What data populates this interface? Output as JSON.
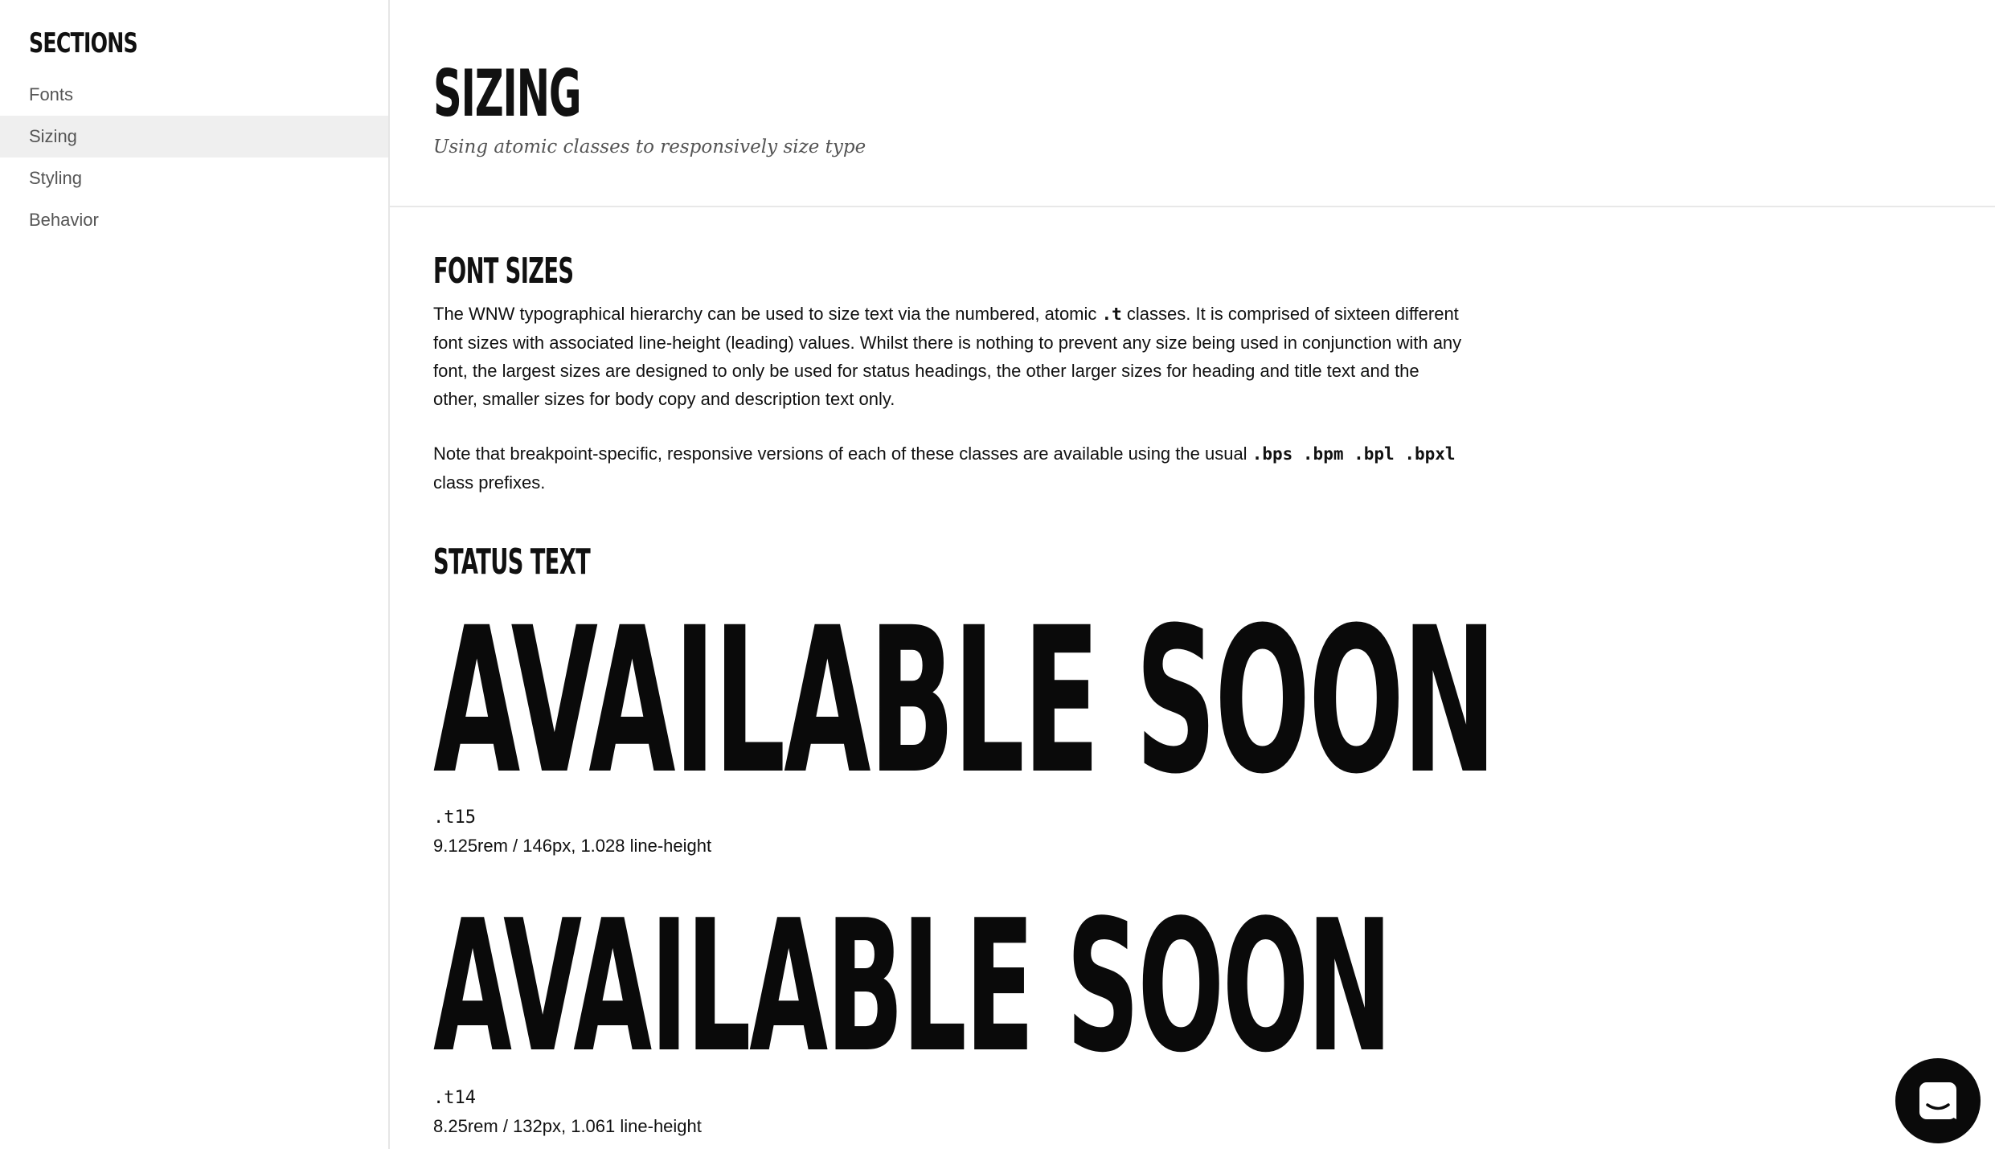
{
  "sidebar": {
    "title": "SECTIONS",
    "items": [
      {
        "label": "Fonts",
        "active": false
      },
      {
        "label": "Sizing",
        "active": true
      },
      {
        "label": "Styling",
        "active": false
      },
      {
        "label": "Behavior",
        "active": false
      }
    ]
  },
  "header": {
    "title": "SIZING",
    "subtitle": "Using atomic classes to responsively size type"
  },
  "font_sizes": {
    "heading": "FONT SIZES",
    "paragraph1": {
      "before_code": "The WNW typographical hierarchy can be used to size text via the numbered, atomic ",
      "code": ".t",
      "after_code": " classes. It is comprised of sixteen different font sizes with associated line-height (leading) values. Whilst there is nothing to prevent any size being used in conjunction with any font, the largest sizes are designed to only be used for status headings, the other larger sizes for heading and title text and the other, smaller sizes for body copy and description text only."
    },
    "paragraph2": {
      "before_code": "Note that breakpoint-specific, responsive versions of each of these classes are available using the usual ",
      "code": ".bps .bpm .bpl .bpxl",
      "after_code": " class prefixes."
    }
  },
  "status_text": {
    "heading": "STATUS TEXT",
    "samples": [
      {
        "text": "AVAILABLE SOON",
        "class_name": ".t15",
        "description": "9.125rem / 146px, 1.028 line-height"
      },
      {
        "text": "AVAILABLE SOON",
        "class_name": ".t14",
        "description": "8.25rem / 132px, 1.061 line-height"
      }
    ]
  },
  "chat_launcher": {
    "icon": "chat-bubble-icon"
  },
  "colors": {
    "text": "#111111",
    "muted": "#555555",
    "active_nav_bg": "#efefef",
    "divider": "#e6e6e6",
    "launcher_bg": "#0a0a0a"
  }
}
